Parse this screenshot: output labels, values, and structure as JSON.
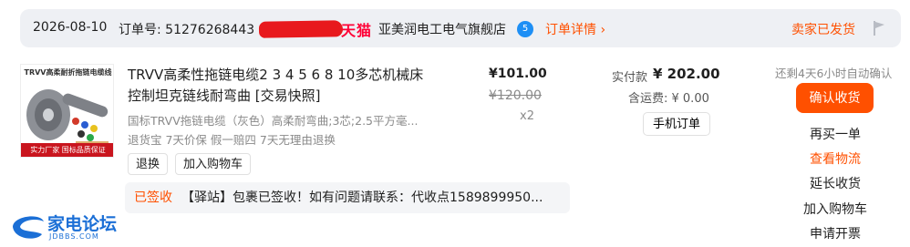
{
  "header": {
    "date": "2026-08-10",
    "order_label": "订单号: 51276268443",
    "tmall_logo": "天猫",
    "shop_name": "亚美润电工电气旗舰店",
    "shop_badge": "5",
    "order_detail": "订单详情 ›",
    "seller_status": "卖家已发货"
  },
  "product": {
    "thumb_top": "TRVV高柔耐折拖链电缆线",
    "thumb_bottom": "实力厂家 国标品质保证",
    "title": "TRVV高柔性拖链电缆2 3 4 5 6 8 10多芯机械床控制坦克链线耐弯曲 [交易快照]",
    "spec": "国标TRVV拖链电缆（灰色）高柔耐弯曲;3芯;2.5平方毫...",
    "service": "退货宝 7天价保 假一赔四 7天无理由退换",
    "return_button": "退换",
    "add_cart_button": "加入购物车",
    "price": "¥101.00",
    "original_price": "¥120.00",
    "quantity": "x2"
  },
  "payment": {
    "paid_label": "实付款",
    "paid_amount": "¥ 202.00",
    "shipping": "含运费: ¥ 0.00",
    "mobile_order_button": "手机订单"
  },
  "actions": {
    "auto_confirm": "还剩4天6小时自动确认",
    "confirm_button": "确认收货",
    "buy_again": "再买一单",
    "view_logistics": "查看物流",
    "extend_receipt": "延长收货",
    "add_to_cart": "加入购物车",
    "apply_invoice": "申请开票"
  },
  "logistics": {
    "status": "已签收",
    "text": "【驿站】包裹已签收！如有问题请联系：代收点1589899950..."
  },
  "watermark": {
    "title": "家电论坛",
    "subtitle": "JDBBS.COM"
  },
  "colors": {
    "accent": "#ff5000",
    "tmall_red": "#ff0036",
    "header_bg": "#eef0f4"
  }
}
